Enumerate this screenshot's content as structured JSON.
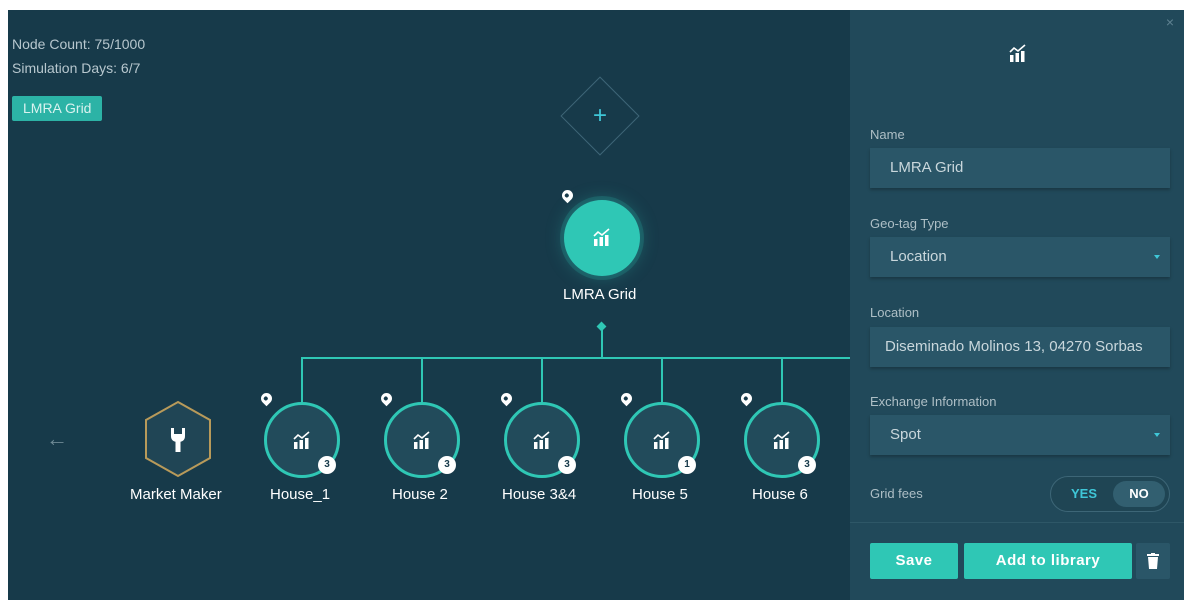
{
  "canvas": {
    "node_count": "Node Count: 75/1000",
    "simulation_days": "Simulation Days: 6/7",
    "grid_tag": "LMRA Grid",
    "main_node": {
      "label": "LMRA Grid"
    },
    "market_maker": {
      "label": "Market Maker"
    },
    "houses": [
      {
        "label": "House_1",
        "badge": "3"
      },
      {
        "label": "House 2",
        "badge": "3"
      },
      {
        "label": "House 3&4",
        "badge": "3"
      },
      {
        "label": "House 5",
        "badge": "1"
      },
      {
        "label": "House 6",
        "badge": "3"
      }
    ]
  },
  "panel": {
    "close": "×",
    "name": {
      "label": "Name",
      "value": "LMRA Grid"
    },
    "geo_tag": {
      "label": "Geo-tag Type",
      "value": "Location"
    },
    "location": {
      "label": "Location",
      "value": "Diseminado Molinos 13, 04270 Sorbas"
    },
    "exchange": {
      "label": "Exchange Information",
      "value": "Spot"
    },
    "grid_fees": {
      "label": "Grid fees",
      "yes": "YES",
      "no": "NO",
      "selected": "NO"
    },
    "buttons": {
      "save": "Save",
      "add_library": "Add to library"
    }
  },
  "colors": {
    "background": "#173a4a",
    "panel": "#21495a",
    "accent": "#2fc7b5",
    "field": "#2a5668"
  }
}
